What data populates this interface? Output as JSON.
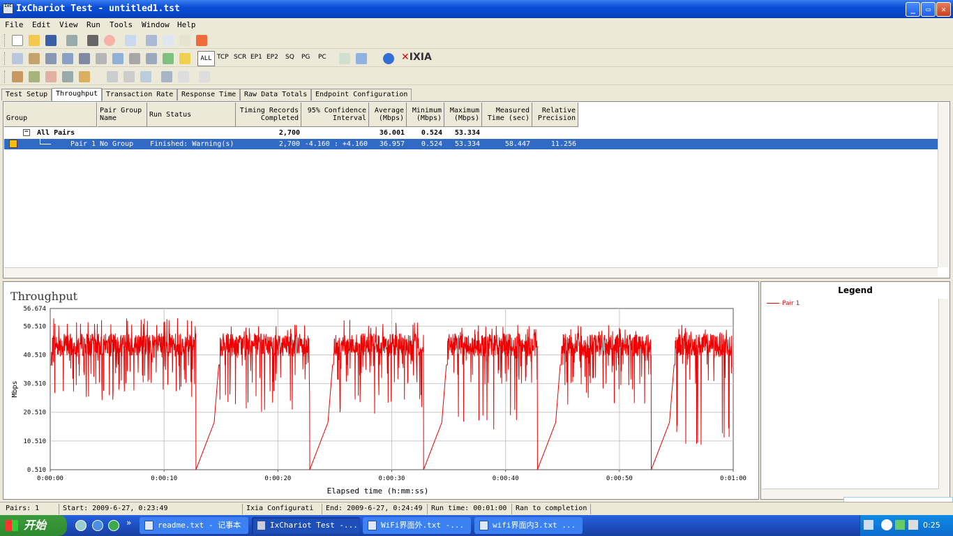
{
  "window": {
    "title": "IxChariot Test - untitled1.tst",
    "app_icon_text": "IxC"
  },
  "window_buttons": {
    "minimize": "_",
    "maximize": "▭",
    "close": "✕"
  },
  "menu": [
    "File",
    "Edit",
    "View",
    "Run",
    "Tools",
    "Window",
    "Help"
  ],
  "toolbar2": {
    "protocols": [
      "ALL",
      "TCP",
      "SCR",
      "EP1",
      "EP2",
      "SQ",
      "PG",
      "PC"
    ],
    "logo": "IXIA"
  },
  "tabs": [
    "Test Setup",
    "Throughput",
    "Transaction Rate",
    "Response Time",
    "Raw Data Totals",
    "Endpoint Configuration"
  ],
  "active_tab": "Throughput",
  "grid": {
    "headers": {
      "group": "Group",
      "pair_group_name": "Pair Group\nName",
      "run_status": "Run Status",
      "timing_records": "Timing Records\nCompleted",
      "confidence": "95% Confidence\nInterval",
      "average": "Average\n(Mbps)",
      "minimum": "Minimum\n(Mbps)",
      "maximum": "Maximum\n(Mbps)",
      "measured_time": "Measured\nTime (sec)",
      "relative_precision": "Relative\nPrecision"
    },
    "all_pairs": {
      "label": "All Pairs",
      "expander": "−",
      "timing_records": "2,700",
      "average": "36.001",
      "minimum": "0.524",
      "maximum": "53.334"
    },
    "pair1": {
      "label": "Pair 1",
      "group": "No Group",
      "run_status": "Finished: Warning(s)",
      "timing_records": "2,700",
      "confidence": "-4.160 : +4.160",
      "average": "36.957",
      "minimum": "0.524",
      "maximum": "53.334",
      "measured_time": "58.447",
      "relative_precision": "11.256"
    }
  },
  "chart": {
    "title": "Throughput"
  },
  "chart_data": {
    "type": "line",
    "ylabel": "Mbps",
    "xlabel": "Elapsed time (h:mm:ss)",
    "ylim": [
      0.51,
      56.674
    ],
    "y_ticks": [
      "56.674",
      "50.510",
      "40.510",
      "30.510",
      "20.510",
      "10.510",
      "0.510"
    ],
    "x_ticks": [
      "0:00:00",
      "0:00:10",
      "0:00:20",
      "0:00:30",
      "0:00:40",
      "0:00:50",
      "0:01:00"
    ],
    "grid": true,
    "color": "#ee0000",
    "series": [
      {
        "name": "Pair 1",
        "bursts": [
          {
            "start": 0.0,
            "end": 12.8,
            "base": 44,
            "min": 24.5,
            "max": 53.3
          },
          {
            "start": 14.8,
            "end": 22.8,
            "base": 44,
            "min": 20.5,
            "max": 51
          },
          {
            "start": 24.8,
            "end": 32.8,
            "base": 44,
            "min": 19.5,
            "max": 52.8
          },
          {
            "start": 34.8,
            "end": 42.8,
            "base": 44,
            "min": 14,
            "max": 51
          },
          {
            "start": 44.8,
            "end": 52.8,
            "base": 44,
            "min": 23,
            "max": 51
          },
          {
            "start": 54.8,
            "end": 59.9,
            "base": 44,
            "min": 8,
            "max": 51
          }
        ],
        "dips_to": 0.524
      }
    ]
  },
  "legend": {
    "title": "Legend",
    "items": [
      "Pair 1"
    ]
  },
  "status": {
    "pairs": "Pairs: 1",
    "start": "Start: 2009-6-27, 0:23:49",
    "config": "Ixia Configurati",
    "end": "End: 2009-6-27, 0:24:49",
    "run_time": "Run time: 00:01:00",
    "result": "Ran to completion"
  },
  "taskbar": {
    "start": "开始",
    "more": "»",
    "tasks": [
      "readme.txt - 记事本",
      "IxChariot Test -...",
      "WiFi界面外.txt -...",
      "wifi界面内3.txt ..."
    ],
    "clock": "0:25"
  },
  "ime": [
    "中",
    "°,"
  ]
}
